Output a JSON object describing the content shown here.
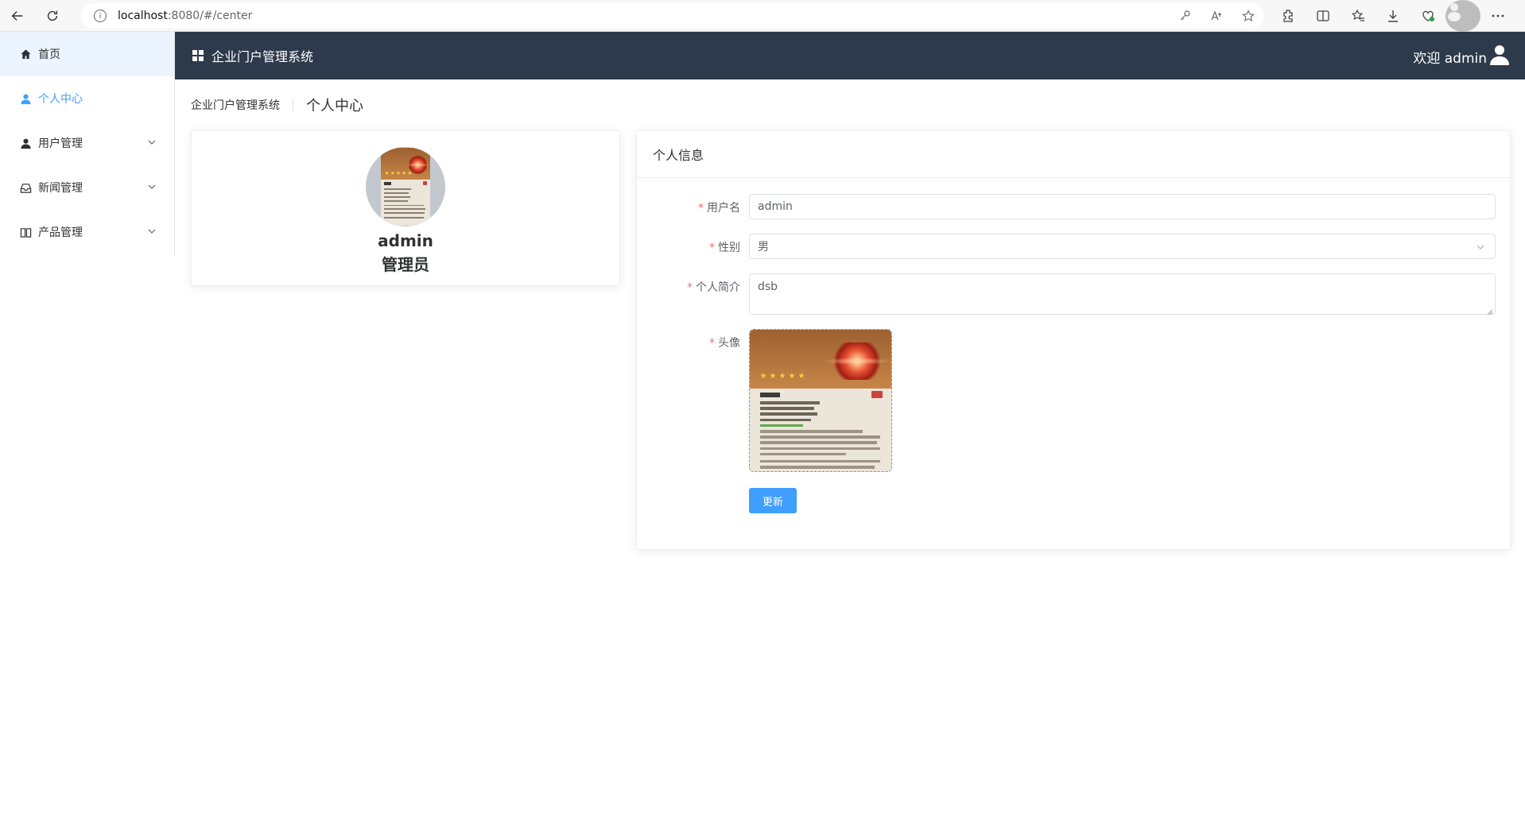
{
  "browser": {
    "url_host": "localhost",
    "url_rest": ":8080/#/center"
  },
  "sidebar": {
    "items": [
      {
        "label": "首页",
        "icon": "home-icon"
      },
      {
        "label": "个人中心",
        "icon": "user-icon",
        "active": true
      },
      {
        "label": "用户管理",
        "icon": "user-icon",
        "expandable": true
      },
      {
        "label": "新闻管理",
        "icon": "inbox-icon",
        "expandable": true
      },
      {
        "label": "产品管理",
        "icon": "book-icon",
        "expandable": true
      }
    ]
  },
  "header": {
    "title": "企业门户管理系统",
    "welcome": "欢迎 admin"
  },
  "breadcrumb": {
    "root": "企业门户管理系统",
    "current": "个人中心"
  },
  "profile": {
    "name": "admin",
    "role": "管理员"
  },
  "info_form": {
    "heading": "个人信息",
    "username_label": "用户名",
    "username_value": "admin",
    "gender_label": "性别",
    "gender_value": "男",
    "bio_label": "个人简介",
    "bio_value": "dsb",
    "avatar_label": "头像",
    "required_mark": "*",
    "update_button": "更新"
  },
  "colors": {
    "header_bg": "#2d3a4b",
    "accent": "#409eff",
    "required": "#f56c6c"
  }
}
